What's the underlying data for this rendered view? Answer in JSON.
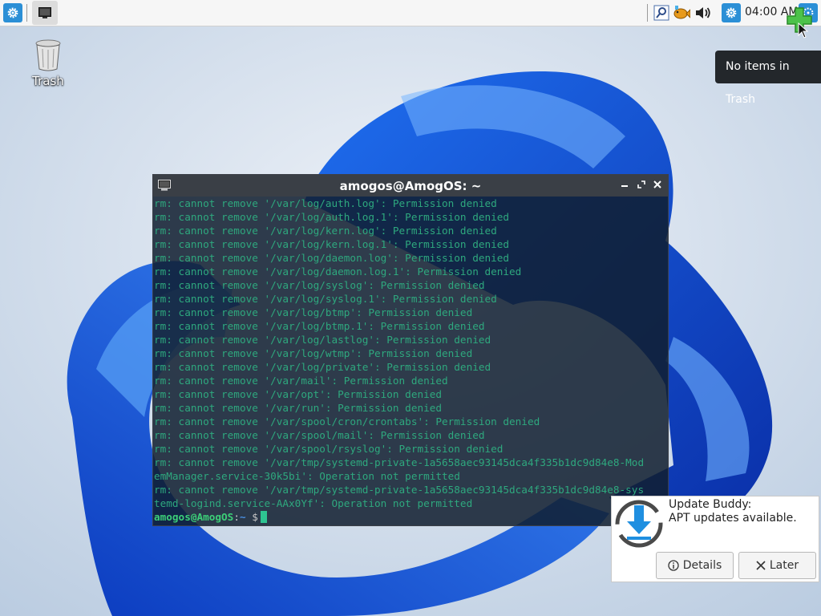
{
  "panel": {
    "clock": "04:00 AM"
  },
  "desktop": {
    "trash_label": "Trash"
  },
  "tooltip": {
    "text": "No items in Trash"
  },
  "terminal": {
    "title": "amogos@AmogOS: ~",
    "lines": [
      "rm: cannot remove '/var/log/auth.log': Permission denied",
      "rm: cannot remove '/var/log/auth.log.1': Permission denied",
      "rm: cannot remove '/var/log/kern.log': Permission denied",
      "rm: cannot remove '/var/log/kern.log.1': Permission denied",
      "rm: cannot remove '/var/log/daemon.log': Permission denied",
      "rm: cannot remove '/var/log/daemon.log.1': Permission denied",
      "rm: cannot remove '/var/log/syslog': Permission denied",
      "rm: cannot remove '/var/log/syslog.1': Permission denied",
      "rm: cannot remove '/var/log/btmp': Permission denied",
      "rm: cannot remove '/var/log/btmp.1': Permission denied",
      "rm: cannot remove '/var/log/lastlog': Permission denied",
      "rm: cannot remove '/var/log/wtmp': Permission denied",
      "rm: cannot remove '/var/log/private': Permission denied",
      "rm: cannot remove '/var/mail': Permission denied",
      "rm: cannot remove '/var/opt': Permission denied",
      "rm: cannot remove '/var/run': Permission denied",
      "rm: cannot remove '/var/spool/cron/crontabs': Permission denied",
      "rm: cannot remove '/var/spool/mail': Permission denied",
      "rm: cannot remove '/var/spool/rsyslog': Permission denied",
      "rm: cannot remove '/var/tmp/systemd-private-1a5658aec93145dca4f335b1dc9d84e8-Mod",
      "emManager.service-30k5bi': Operation not permitted",
      "rm: cannot remove '/var/tmp/systemd-private-1a5658aec93145dca4f335b1dc9d84e8-sys",
      "temd-logind.service-AAx0Yf': Operation not permitted"
    ],
    "prompt": {
      "user_host": "amogos@AmogOS",
      "separator": ":",
      "path": "~",
      "symbol": " $"
    }
  },
  "notification": {
    "title": "Update Buddy:",
    "body": "APT updates available.",
    "details_label": "Details",
    "later_label": "Later"
  },
  "colors": {
    "terminal_text": "#2ea87e",
    "prompt_user": "#3ccf78",
    "prompt_path": "#4a8fe0",
    "accent": "#2b8fd6"
  }
}
